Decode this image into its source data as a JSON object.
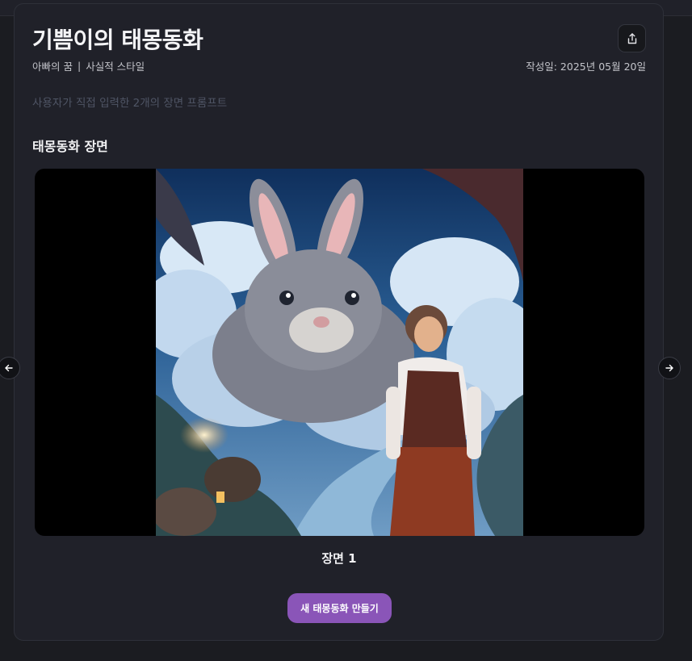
{
  "story": {
    "title": "기쁨이의 태몽동화",
    "category": "아빠의 꿈",
    "separator": "|",
    "style": "사실적 스타일",
    "created_date": "작성일: 2025년 05월 20일",
    "prompt_note": "사용자가 직접 입력한 2개의 장면 프롬프트"
  },
  "scenes": {
    "section_title": "태몽동화 장면",
    "current_label": "장면 1"
  },
  "actions": {
    "create_new_label": "새 태몽동화 만들기"
  },
  "icons": {
    "share": "share-icon",
    "prev": "arrow-left-icon",
    "next": "arrow-right-icon"
  },
  "colors": {
    "accent": "#8a55b8",
    "background": "#1b1c21",
    "card": "#202129"
  }
}
